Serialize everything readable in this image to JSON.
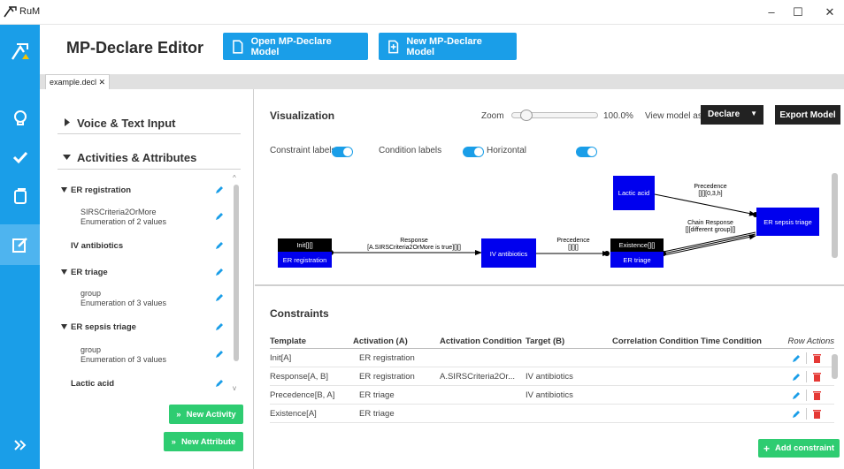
{
  "window": {
    "title": "RuM",
    "minimize": "–",
    "maximize": "☐",
    "close": "✕"
  },
  "header": {
    "title": "MP-Declare Editor",
    "open_btn": "Open MP-Declare Model",
    "new_btn": "New MP-Declare Model"
  },
  "tab": {
    "label": "example.decl ✕"
  },
  "left": {
    "voice_section": "Voice & Text Input",
    "activities_section": "Activities & Attributes",
    "items": [
      {
        "name": "ER registration",
        "attrs": [
          {
            "name": "SIRSCriteria2OrMore",
            "desc": "Enumeration of 2 values"
          }
        ]
      },
      {
        "name": "IV antibiotics",
        "attrs": []
      },
      {
        "name": "ER triage",
        "attrs": [
          {
            "name": "group",
            "desc": "Enumeration of 3 values"
          }
        ]
      },
      {
        "name": "ER sepsis triage",
        "attrs": [
          {
            "name": "group",
            "desc": "Enumeration of 3 values"
          }
        ]
      },
      {
        "name": "Lactic acid",
        "attrs": []
      }
    ],
    "new_activity": "New Activity",
    "new_attribute": "New Attribute"
  },
  "viz": {
    "title": "Visualization",
    "zoom_label": "Zoom",
    "zoom_value": "100.0%",
    "zoom_level": 0.1,
    "view_as_label": "View model as:",
    "view_as_value": "Declare",
    "export_btn": "Export Model",
    "toggles": {
      "constraint_labels": "Constraint labels",
      "condition_labels": "Condition labels",
      "horizontal": "Horizontal"
    },
    "nodes": {
      "init_top": "Init[][]",
      "er_registration": "ER registration",
      "iv_antibiotics": "IV antibiotics",
      "existence_top": "Existence[][]",
      "er_triage": "ER triage",
      "lactic_acid": "Lactic acid",
      "er_sepsis_triage": "ER sepsis triage"
    },
    "edges": {
      "response_1": "Response",
      "response_2": "[A.SIRSCriteria2OrMore is true][][]",
      "precedence_a1": "Precedence",
      "precedence_a2": "[][][]",
      "precedence_b1": "Precedence",
      "precedence_b2": "[][][0,3,h]",
      "chain_1": "Chain Response",
      "chain_2": "[][different group][]"
    }
  },
  "constraints": {
    "title": "Constraints",
    "columns": [
      "Template",
      "Activation (A)",
      "Activation Condition",
      "Target (B)",
      "Correlation Condition",
      "Time Condition",
      "Row Actions"
    ],
    "rows": [
      [
        "Init[A]",
        "ER registration",
        "",
        "",
        "",
        ""
      ],
      [
        "Response[A, B]",
        "ER registration",
        "A.SIRSCriteria2Or...",
        "IV antibiotics",
        "",
        ""
      ],
      [
        "Precedence[B, A]",
        "ER triage",
        "",
        "IV antibiotics",
        "",
        ""
      ],
      [
        "Existence[A]",
        "ER triage",
        "",
        "",
        "",
        ""
      ]
    ],
    "add_btn": "Add constraint"
  },
  "colors": {
    "accent": "#1a9ee8",
    "green": "#2ecc71",
    "node": "#0000ee",
    "delete": "#e53935"
  }
}
